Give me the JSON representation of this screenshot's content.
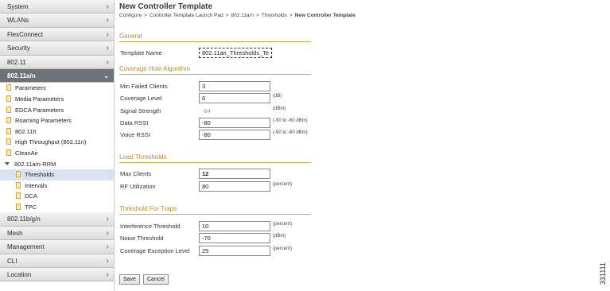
{
  "sidebar": {
    "top_categories": [
      {
        "label": "System"
      },
      {
        "label": "WLANs"
      },
      {
        "label": "FlexConnect"
      },
      {
        "label": "Security"
      },
      {
        "label": "802.11"
      }
    ],
    "active_category": {
      "label": "802.11a/n"
    },
    "sub_items": [
      {
        "label": "Parameters"
      },
      {
        "label": "Media Parameters"
      },
      {
        "label": "EDCA Parameters"
      },
      {
        "label": "Roaming Parameters"
      },
      {
        "label": "802.11h"
      },
      {
        "label": "High Throughput (802.11n)"
      },
      {
        "label": "CleanAir"
      }
    ],
    "rrm_group": {
      "label": "802.11a/n-RRM",
      "items": [
        {
          "label": "Thresholds"
        },
        {
          "label": "Intervals"
        },
        {
          "label": "DCA"
        },
        {
          "label": "TPC"
        }
      ]
    },
    "bottom_categories": [
      {
        "label": "802.11b/g/n"
      },
      {
        "label": "Mesh"
      },
      {
        "label": "Management"
      },
      {
        "label": "CLI"
      },
      {
        "label": "Location"
      }
    ],
    "chevron": "›",
    "active_chevron": "⌄"
  },
  "header": {
    "title": "New Controller Template",
    "breadcrumb": [
      "Configure",
      "Controller Template Launch Pad",
      "802.11a/n",
      "Thresholds"
    ],
    "breadcrumb_current": "New Controller Template",
    "breadcrumb_sep": ">"
  },
  "general": {
    "heading": "General",
    "template_name_label": "Template Name",
    "template_name_value": "802.11an_Thresholds_Te"
  },
  "coverage": {
    "heading": "Coverage Hole Algorithm",
    "min_failed_clients_label": "Min Failed Clients",
    "min_failed_clients_value": "3",
    "coverage_level_label": "Coverage Level",
    "coverage_level_value": "6",
    "coverage_level_unit": "(dB)",
    "signal_strength_label": "Signal Strength",
    "signal_strength_value": "-84",
    "signal_strength_unit": "(dBm)",
    "data_rssi_label": "Data RSSI",
    "data_rssi_value": "-80",
    "data_rssi_unit": "(-90 to -60 dBm)",
    "voice_rssi_label": "Voice RSSI",
    "voice_rssi_value": "-80",
    "voice_rssi_unit": "(-90 to -60 dBm)"
  },
  "load": {
    "heading": "Load Thresholds",
    "max_clients_label": "Max Clients",
    "max_clients_value": "12",
    "rf_util_label": "RF Utilization",
    "rf_util_value": "80",
    "rf_util_unit": "(percent)"
  },
  "traps": {
    "heading": "Threshold For Traps",
    "interference_label": "Interference Threshold",
    "interference_value": "10",
    "interference_unit": "(percent)",
    "noise_label": "Noise Threshold",
    "noise_value": "-70",
    "noise_unit": "(dBm)",
    "coverage_exc_label": "Coverage Exception Level",
    "coverage_exc_value": "25",
    "coverage_exc_unit": "(percent)"
  },
  "buttons": {
    "save": "Save",
    "cancel": "Cancel"
  },
  "figure_id": "331111",
  "colors": {
    "section_heading": "#c08a2c",
    "active_nav": "#6f7379",
    "selected_item": "#d9e3ef"
  }
}
